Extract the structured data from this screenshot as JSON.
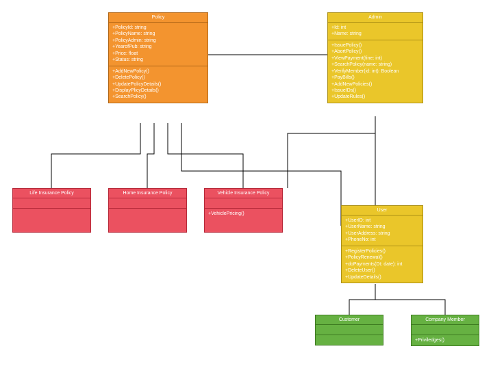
{
  "policy": {
    "title": "Policy",
    "attrs": [
      "+PolicyId: string",
      "+PolicyName: string",
      "+PolicyAdmin: string",
      "+YearofPub: string",
      "+Price: float",
      "+Status: string"
    ],
    "ops": [
      "+AddNewPolicy()",
      "+DeletePolicy()",
      "+UpdatePolicyDetails()",
      "+DisplayPlicyDetails()",
      "+SearchPolicy()"
    ]
  },
  "admin": {
    "title": "Admin",
    "attrs": [
      "+Id: int",
      "+Name: string"
    ],
    "ops": [
      "+IssuePolicy()",
      "+AbortPolicy()",
      "+ViewPayment(fine: int)",
      "+SearchPolicy(name: string)",
      "+VerifyMember(id: int): Boolean",
      "+PayBills()",
      "+AddNewPolicies()",
      "+IssueIDs()",
      "+UpdateRules()"
    ]
  },
  "user": {
    "title": "User",
    "attrs": [
      "+UserID: int",
      "+UserName: string",
      "+UserAddress: string",
      "+PhoneNo: int"
    ],
    "ops": [
      "+RegisterPolicies()",
      "+PolicyRenewal()",
      "+doPayments(Dt: date): int",
      "+DeleteUser()",
      "+UpdateDetails()"
    ]
  },
  "life": {
    "title": "Life Insurance Policy"
  },
  "home": {
    "title": "Home Insurance Policy"
  },
  "vehicle": {
    "title": "Vehicle Insurance Policy",
    "ops": [
      "+VehiclePricing()"
    ]
  },
  "customer": {
    "title": "Customer"
  },
  "company": {
    "title": "Company Member",
    "ops": [
      "+Priviledges()"
    ]
  }
}
